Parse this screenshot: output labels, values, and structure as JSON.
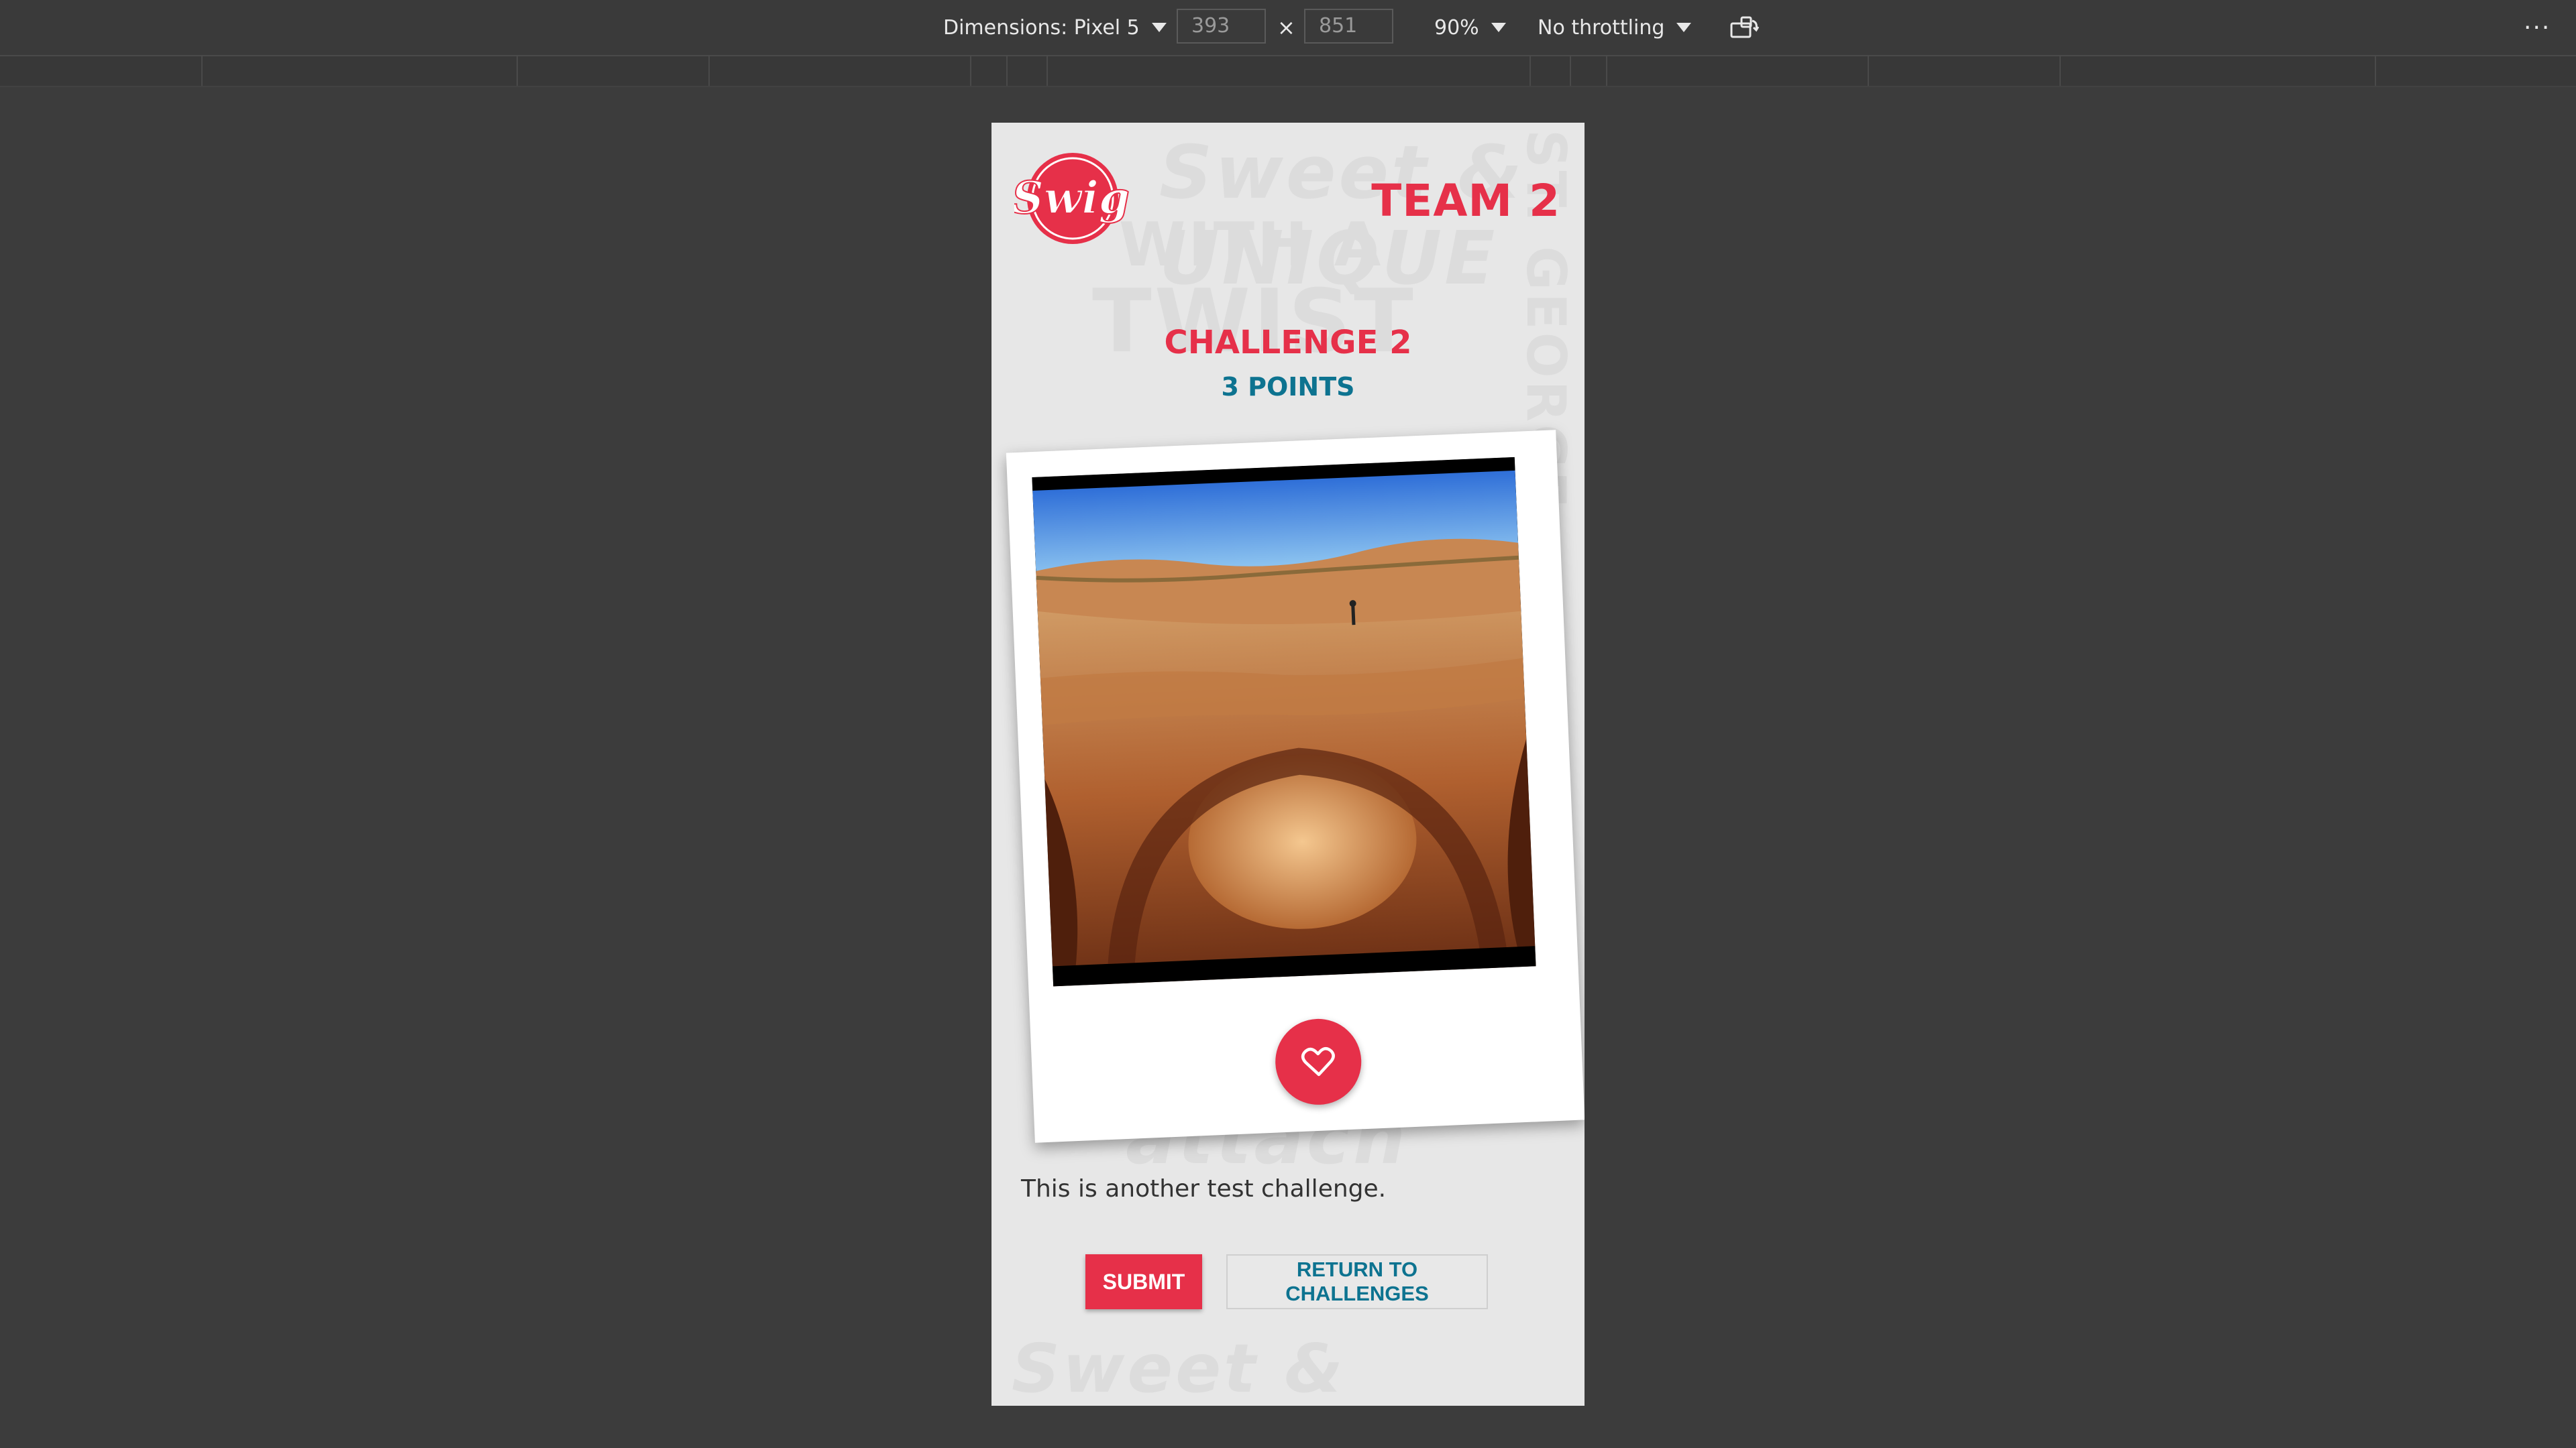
{
  "devtools": {
    "dimensions_label": "Dimensions: Pixel 5",
    "width_value": "393",
    "height_value": "851",
    "times_symbol": "×",
    "zoom": "90%",
    "throttling": "No throttling",
    "more_label": "···"
  },
  "app": {
    "logo_text": "Swig",
    "team": "TEAM 2",
    "challenge_title": "CHALLENGE 2",
    "points": "3 POINTS",
    "description": "This is another test challenge.",
    "submit_label": "SUBMIT",
    "return_label": "RETURN TO CHALLENGES",
    "accent_color": "#e63049",
    "secondary_color": "#0d7390"
  },
  "background_pattern": {
    "lines": [
      "Sweet & UNIQUE",
      "WITH A",
      "TWIST",
      "ST. GEORGE",
      "attach",
      "Sweet & UNIQUE"
    ]
  },
  "icons": {
    "like": "heart-icon",
    "rotate": "rotate-device-icon"
  }
}
